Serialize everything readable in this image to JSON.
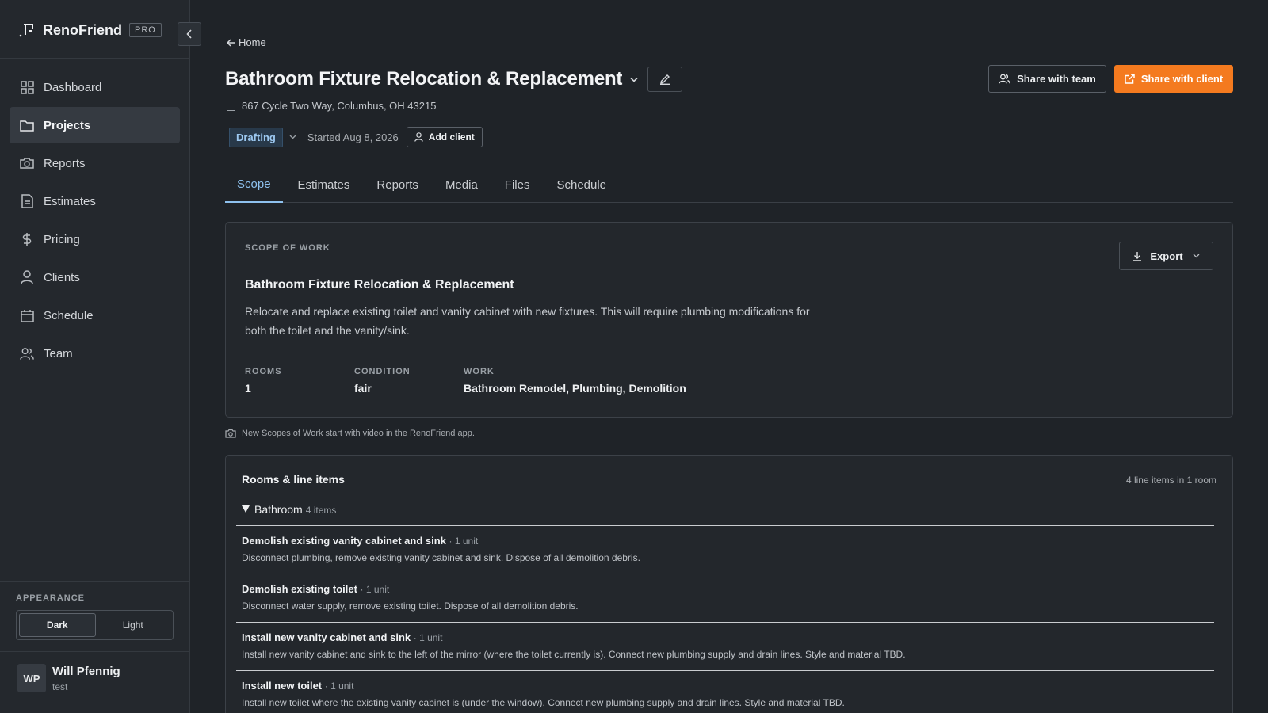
{
  "sidebar": {
    "brand": "RenoFriend",
    "badge": "PRO",
    "items": [
      {
        "label": "Dashboard",
        "icon": "dashboard-icon"
      },
      {
        "label": "Projects",
        "icon": "folder-icon"
      },
      {
        "label": "Reports",
        "icon": "camera-icon"
      },
      {
        "label": "Estimates",
        "icon": "document-icon"
      },
      {
        "label": "Pricing",
        "icon": "dollar-icon"
      },
      {
        "label": "Clients",
        "icon": "user-icon"
      },
      {
        "label": "Schedule",
        "icon": "calendar-icon"
      },
      {
        "label": "Team",
        "icon": "users-icon"
      }
    ],
    "active_item": "Projects",
    "appearance": {
      "label": "APPEARANCE",
      "dark": "Dark",
      "light": "Light",
      "selected": "Dark"
    },
    "user": {
      "initials": "WP",
      "name": "Will Pfennig",
      "subtitle": "test"
    }
  },
  "header": {
    "back": "Home",
    "title": "Bathroom Fixture Relocation & Replacement",
    "address": "867 Cycle Two Way, Columbus, OH 43215",
    "status": "Drafting",
    "started": "Started Aug 8, 2026",
    "add_client": "Add client",
    "share_team": "Share with team",
    "share_client": "Share with client"
  },
  "tabs": [
    "Scope",
    "Estimates",
    "Reports",
    "Media",
    "Files",
    "Schedule"
  ],
  "active_tab": "Scope",
  "scope": {
    "label": "SCOPE OF WORK",
    "export": "Export",
    "title": "Bathroom Fixture Relocation & Replacement",
    "description": "Relocate and replace existing toilet and vanity cabinet with new fixtures. This will require plumbing modifications for both the toilet and the vanity/sink.",
    "stats": [
      {
        "label": "ROOMS",
        "value": "1"
      },
      {
        "label": "CONDITION",
        "value": "fair"
      },
      {
        "label": "WORK",
        "value": "Bathroom Remodel, Plumbing, Demolition"
      }
    ]
  },
  "notice": "New Scopes of Work start with video in the RenoFriend app.",
  "rooms": {
    "title": "Rooms & line items",
    "count": "4 line items in 1 room",
    "room_name": "Bathroom",
    "room_items": "4 items",
    "line_items": [
      {
        "title": "Demolish existing vanity cabinet and sink",
        "unit": "· 1 unit",
        "desc": "Disconnect plumbing, remove existing vanity cabinet and sink. Dispose of all demolition debris."
      },
      {
        "title": "Demolish existing toilet",
        "unit": "· 1 unit",
        "desc": "Disconnect water supply, remove existing toilet. Dispose of all demolition debris."
      },
      {
        "title": "Install new vanity cabinet and sink",
        "unit": "· 1 unit",
        "desc": "Install new vanity cabinet and sink to the left of the mirror (where the toilet currently is). Connect new plumbing supply and drain lines. Style and material TBD."
      },
      {
        "title": "Install new toilet",
        "unit": "· 1 unit",
        "desc": "Install new toilet where the existing vanity cabinet is (under the window). Connect new plumbing supply and drain lines. Style and material TBD."
      }
    ]
  },
  "colors": {
    "accent": "#f47a1f",
    "tab_active": "#8ec1ee",
    "status_bg": "#28394a"
  }
}
